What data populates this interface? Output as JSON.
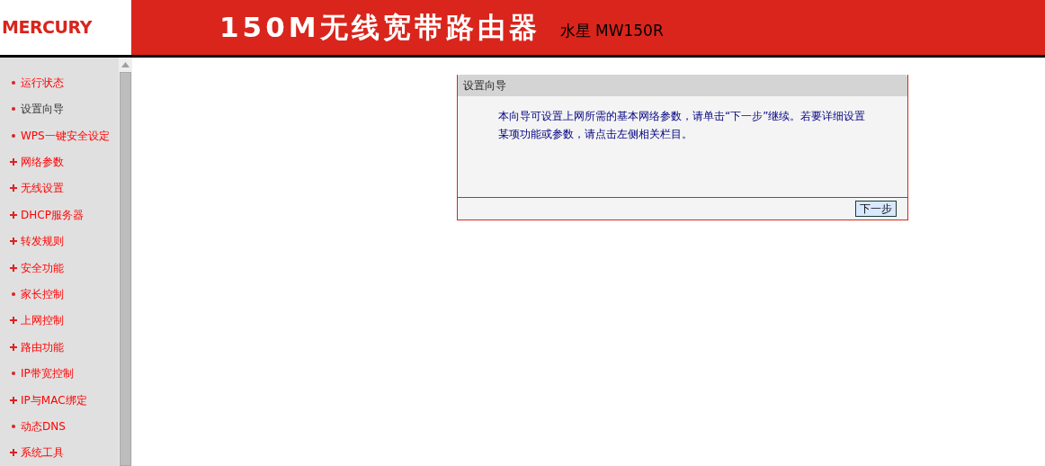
{
  "header": {
    "logo": "MERCURY",
    "title": "150M无线宽带路由器",
    "model": "水星 MW150R"
  },
  "sidebar": {
    "items": [
      {
        "label": "运行状态",
        "expandable": false,
        "selected": false
      },
      {
        "label": "设置向导",
        "expandable": false,
        "selected": true
      },
      {
        "label": "WPS一键安全设定",
        "expandable": false,
        "selected": false
      },
      {
        "label": "网络参数",
        "expandable": true,
        "selected": false
      },
      {
        "label": "无线设置",
        "expandable": true,
        "selected": false
      },
      {
        "label": "DHCP服务器",
        "expandable": true,
        "selected": false
      },
      {
        "label": "转发规则",
        "expandable": true,
        "selected": false
      },
      {
        "label": "安全功能",
        "expandable": true,
        "selected": false
      },
      {
        "label": "家长控制",
        "expandable": false,
        "selected": false
      },
      {
        "label": "上网控制",
        "expandable": true,
        "selected": false
      },
      {
        "label": "路由功能",
        "expandable": true,
        "selected": false
      },
      {
        "label": "IP带宽控制",
        "expandable": false,
        "selected": false
      },
      {
        "label": "IP与MAC绑定",
        "expandable": true,
        "selected": false
      },
      {
        "label": "动态DNS",
        "expandable": false,
        "selected": false
      },
      {
        "label": "系统工具",
        "expandable": true,
        "selected": false
      }
    ]
  },
  "panel": {
    "title": "设置向导",
    "text": "本向导可设置上网所需的基本网络参数，请单击“下一步”继续。若要详细设置某项功能或参数，请点击左侧相关栏目。",
    "button": "下一步"
  }
}
